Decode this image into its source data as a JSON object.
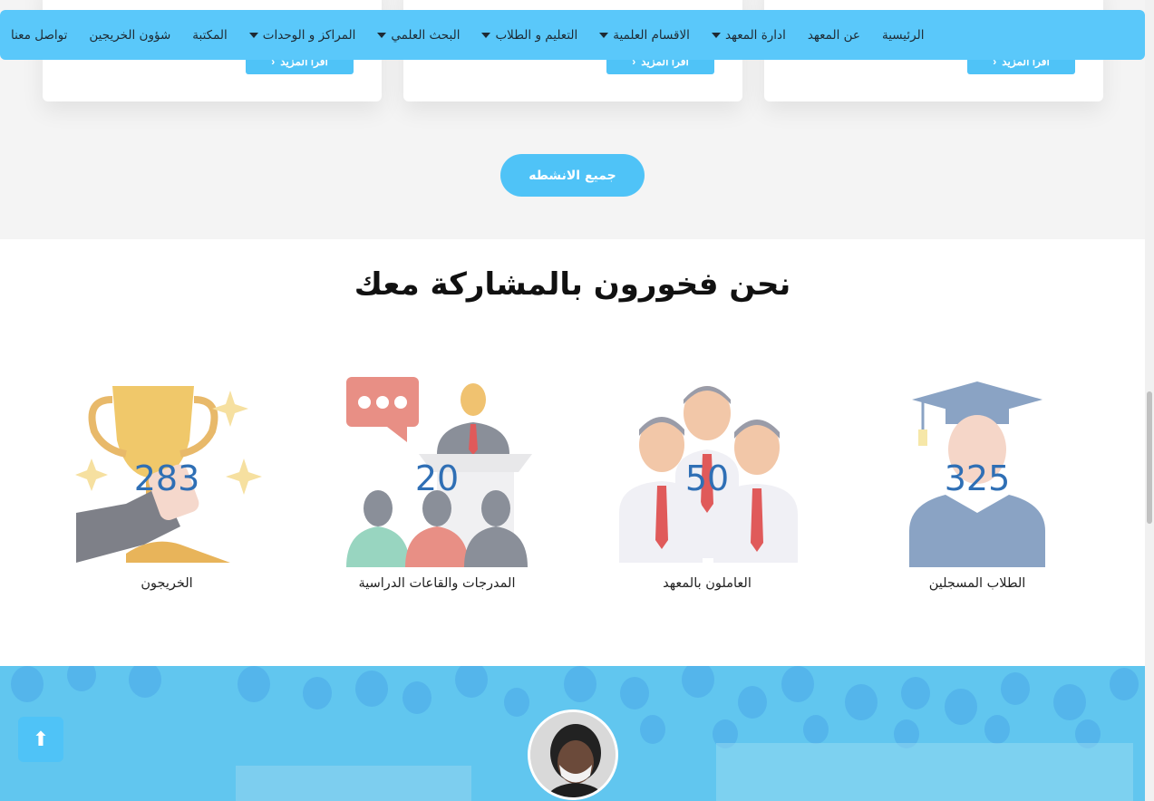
{
  "nav": {
    "items": [
      {
        "label": "الرئيسية",
        "dropdown": false
      },
      {
        "label": "عن المعهد",
        "dropdown": false
      },
      {
        "label": "ادارة المعهد",
        "dropdown": true
      },
      {
        "label": "الاقسام العلمية",
        "dropdown": true
      },
      {
        "label": "التعليم و الطلاب",
        "dropdown": true
      },
      {
        "label": "البحث العلمي",
        "dropdown": true
      },
      {
        "label": "المراكز و الوحدات",
        "dropdown": true
      },
      {
        "label": "المكتبة",
        "dropdown": false
      },
      {
        "label": "شؤون الخريجين",
        "dropdown": false
      },
      {
        "label": "تواصل معنا",
        "dropdown": false
      }
    ]
  },
  "cards": {
    "more_label": "اقرأ المزيد"
  },
  "activities": {
    "all_button": "جميع الانشطه"
  },
  "stats": {
    "title": "نحن فخورون بالمشاركة معك",
    "items": [
      {
        "value": "325",
        "label": "الطلاب المسجلين",
        "icon": "graduate-icon"
      },
      {
        "value": "50",
        "label": "العاملون بالمعهد",
        "icon": "staff-icon"
      },
      {
        "value": "20",
        "label": "المدرجات والقاعات الدراسية",
        "icon": "lecture-hall-icon"
      },
      {
        "value": "283",
        "label": "الخريجون",
        "icon": "trophy-icon"
      }
    ]
  },
  "colors": {
    "accent": "#5ac8fa",
    "button": "#4fc3f7",
    "number": "#2f6fb5"
  },
  "scroll_top_icon": "arrow-up-icon"
}
